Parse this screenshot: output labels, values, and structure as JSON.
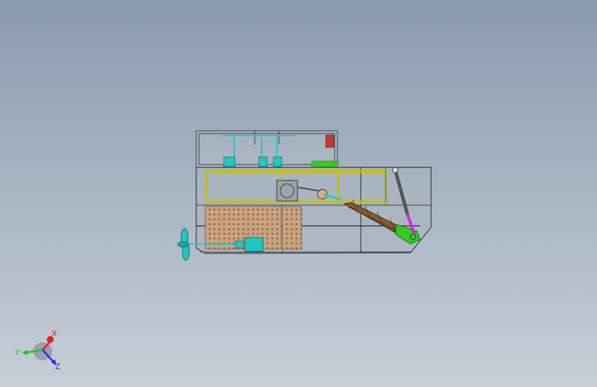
{
  "viewport": {
    "background_top": "#8a9aae",
    "background_bottom": "#c7ced7"
  },
  "model": {
    "outline_color": "#3a3a3a",
    "frame_color": "#c8c000",
    "pegboard_color": "#c9a27e",
    "cyan_parts_color": "#1fc7c7",
    "green_parts_color": "#33cc22",
    "magenta_part_color": "#e020e0",
    "conveyor_color": "#8a5a2a"
  },
  "triad": {
    "x_label": "X",
    "y_label": "Y",
    "z_label": "Z",
    "x_color": "#e02020",
    "y_color": "#20c020",
    "z_color": "#2030e0"
  }
}
